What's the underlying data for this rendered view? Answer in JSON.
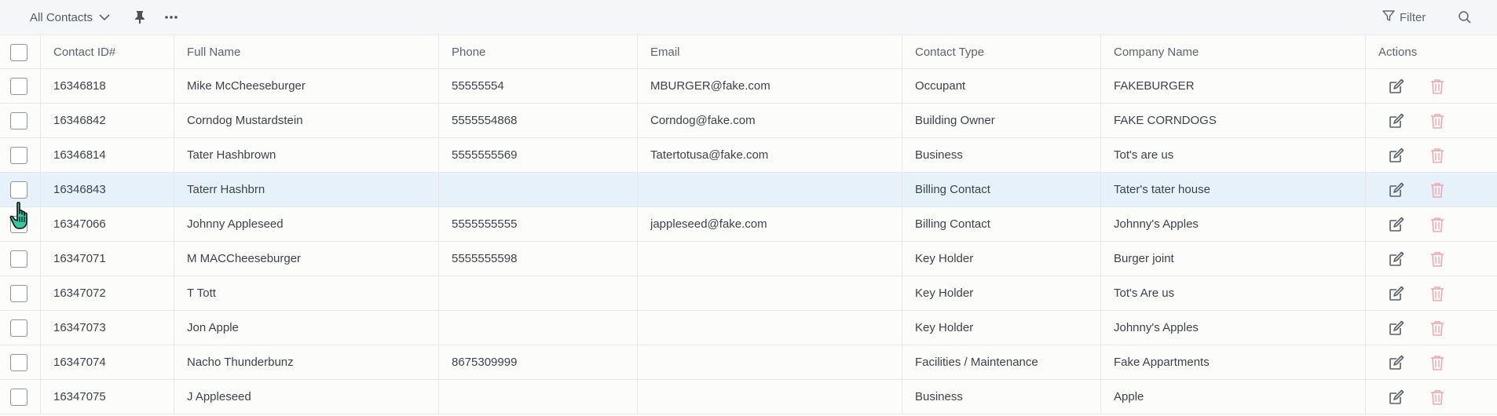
{
  "toolbar": {
    "view_label": "All Contacts",
    "filter_label": "Filter"
  },
  "columns": {
    "contact_id": "Contact ID#",
    "full_name": "Full Name",
    "phone": "Phone",
    "email": "Email",
    "contact_type": "Contact Type",
    "company": "Company Name",
    "actions": "Actions"
  },
  "rows": [
    {
      "id": "16346818",
      "name": "Mike McCheeseburger",
      "phone": "55555554",
      "email": "MBURGER@fake.com",
      "type": "Occupant",
      "company": "FAKEBURGER"
    },
    {
      "id": "16346842",
      "name": "Corndog Mustardstein",
      "phone": "5555554868",
      "email": "Corndog@fake.com",
      "type": "Building Owner",
      "company": "FAKE CORNDOGS"
    },
    {
      "id": "16346814",
      "name": "Tater Hashbrown",
      "phone": "5555555569",
      "email": "Tatertotusa@fake.com",
      "type": "Business",
      "company": "Tot's are us"
    },
    {
      "id": "16346843",
      "name": "Taterr Hashbrn",
      "phone": "",
      "email": "",
      "type": "Billing Contact",
      "company": "Tater's tater house"
    },
    {
      "id": "16347066",
      "name": "Johnny Appleseed",
      "phone": "5555555555",
      "email": "jappleseed@fake.com",
      "type": "Billing Contact",
      "company": "Johnny's Apples"
    },
    {
      "id": "16347071",
      "name": "M MACCheeseburger",
      "phone": "5555555598",
      "email": "",
      "type": "Key Holder",
      "company": "Burger joint"
    },
    {
      "id": "16347072",
      "name": "T Tott",
      "phone": "",
      "email": "",
      "type": "Key Holder",
      "company": "Tot's Are us"
    },
    {
      "id": "16347073",
      "name": "Jon Apple",
      "phone": "",
      "email": "",
      "type": "Key Holder",
      "company": "Johnny's Apples"
    },
    {
      "id": "16347074",
      "name": "Nacho Thunderbunz",
      "phone": "8675309999",
      "email": "",
      "type": "Facilities / Maintenance",
      "company": "Fake Appartments"
    },
    {
      "id": "16347075",
      "name": "J Appleseed",
      "phone": "",
      "email": "",
      "type": "Business",
      "company": "Apple"
    }
  ],
  "highlighted_row": 3,
  "colors": {
    "toolbar_bg": "#f5f6f8",
    "row_highlight": "#e6f1fa",
    "delete_icon": "#f1a7b0",
    "edit_icon": "#5a6068",
    "cursor_fill": "#37c9a6"
  },
  "icons": {
    "view_dropdown": "chevron-down-icon",
    "pin": "pin-icon",
    "more": "more-horizontal-icon",
    "filter": "filter-icon",
    "search": "search-icon",
    "edit": "edit-icon",
    "delete": "trash-icon"
  }
}
